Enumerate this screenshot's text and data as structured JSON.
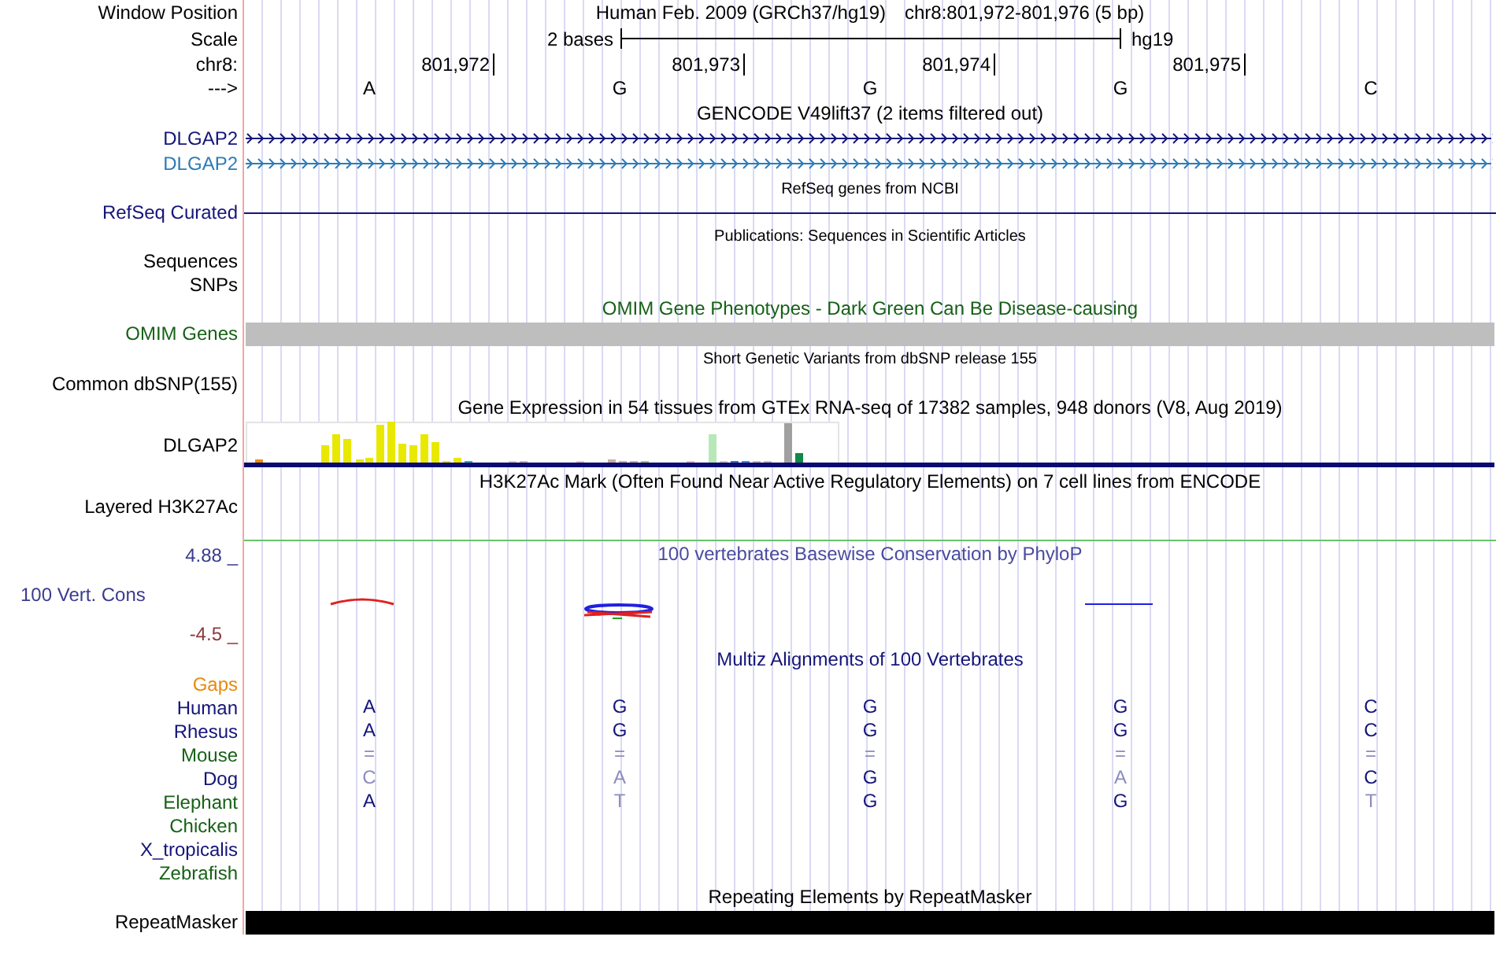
{
  "header": {
    "position_label": "Window Position",
    "assembly_title": "Human Feb. 2009 (GRCh37/hg19)",
    "position": "chr8:801,972-801,976 (5 bp)",
    "scale_label": "Scale",
    "scale_text": "2 bases",
    "scale_db": "hg19",
    "chrom_label": "chr8:",
    "ticks": [
      "801,972",
      "801,973",
      "801,974",
      "801,975"
    ],
    "strand_label": "--->",
    "bases": [
      "A",
      "G",
      "G",
      "G",
      "C"
    ]
  },
  "tracks": [
    {
      "kind": "title",
      "text": "GENCODE V49lift37 (2 items filtered out)"
    },
    {
      "kind": "gene",
      "label": "DLGAP2",
      "color": "#14147a"
    },
    {
      "kind": "gene",
      "label": "DLGAP2",
      "color": "#2c7bb6"
    },
    {
      "kind": "note",
      "text": "RefSeq genes from NCBI"
    },
    {
      "kind": "line",
      "label": "RefSeq Curated",
      "color": "#14147a"
    },
    {
      "kind": "note",
      "text": "Publications: Sequences in Scientific Articles"
    },
    {
      "kind": "label",
      "label": "Sequences"
    },
    {
      "kind": "label",
      "label": "SNPs"
    },
    {
      "kind": "title",
      "text": "OMIM Gene Phenotypes - Dark Green Can Be Disease-causing",
      "color": "#176117"
    },
    {
      "kind": "omim",
      "label": "OMIM Genes",
      "color": "#176117"
    },
    {
      "kind": "note",
      "text": "Short Genetic Variants from dbSNP release 155"
    },
    {
      "kind": "label",
      "label": "Common dbSNP(155)"
    },
    {
      "kind": "title",
      "text": "Gene Expression in 54 tissues from GTEx RNA-seq of 17382 samples, 948 donors (V8, Aug 2019)"
    },
    {
      "kind": "gtex",
      "label": "DLGAP2"
    },
    {
      "kind": "title",
      "text": "H3K27Ac Mark (Often Found Near Active Regulatory Elements) on 7 cell lines from ENCODE"
    },
    {
      "kind": "label",
      "label": "Layered H3K27Ac"
    },
    {
      "kind": "phylop",
      "label": "100 Vert. Cons",
      "max": "4.88 _",
      "min": "-4.5 _",
      "title": "100 vertebrates Basewise Conservation by PhyloP"
    },
    {
      "kind": "title",
      "text": "Multiz Alignments of 100 Vertebrates",
      "color": "#14147a"
    },
    {
      "kind": "species",
      "label": "Gaps",
      "color": "#e8890c"
    },
    {
      "kind": "species",
      "label": "Human",
      "color": "#14147a",
      "bases": [
        {
          "text": "A",
          "faint": false
        },
        {
          "text": "G",
          "faint": false
        },
        {
          "text": "G",
          "faint": false
        },
        {
          "text": "G",
          "faint": false
        },
        {
          "text": "C",
          "faint": false
        }
      ]
    },
    {
      "kind": "species",
      "label": "Rhesus",
      "color": "#14147a",
      "bases": [
        {
          "text": "A",
          "faint": false
        },
        {
          "text": "G",
          "faint": false
        },
        {
          "text": "G",
          "faint": false
        },
        {
          "text": "G",
          "faint": false
        },
        {
          "text": "C",
          "faint": false
        }
      ]
    },
    {
      "kind": "species",
      "label": "Mouse",
      "color": "#176117",
      "bases": [
        {
          "text": "=",
          "faint": true
        },
        {
          "text": "=",
          "faint": true
        },
        {
          "text": "=",
          "faint": true
        },
        {
          "text": "=",
          "faint": true
        },
        {
          "text": "=",
          "faint": true
        }
      ]
    },
    {
      "kind": "species",
      "label": "Dog",
      "color": "#14147a",
      "bases": [
        {
          "text": "C",
          "faint": true
        },
        {
          "text": "A",
          "faint": true
        },
        {
          "text": "G",
          "faint": false
        },
        {
          "text": "A",
          "faint": true
        },
        {
          "text": "C",
          "faint": false
        }
      ]
    },
    {
      "kind": "species",
      "label": "Elephant",
      "color": "#176117",
      "bases": [
        {
          "text": "A",
          "faint": false
        },
        {
          "text": "T",
          "faint": true
        },
        {
          "text": "G",
          "faint": false
        },
        {
          "text": "G",
          "faint": false
        },
        {
          "text": "T",
          "faint": true
        }
      ]
    },
    {
      "kind": "species",
      "label": "Chicken",
      "color": "#176117"
    },
    {
      "kind": "species",
      "label": "X_tropicalis",
      "color": "#14147a"
    },
    {
      "kind": "species",
      "label": "Zebrafish",
      "color": "#176117"
    },
    {
      "kind": "title",
      "text": "Repeating Elements by RepeatMasker"
    },
    {
      "kind": "repeats",
      "label": "RepeatMasker"
    }
  ]
}
